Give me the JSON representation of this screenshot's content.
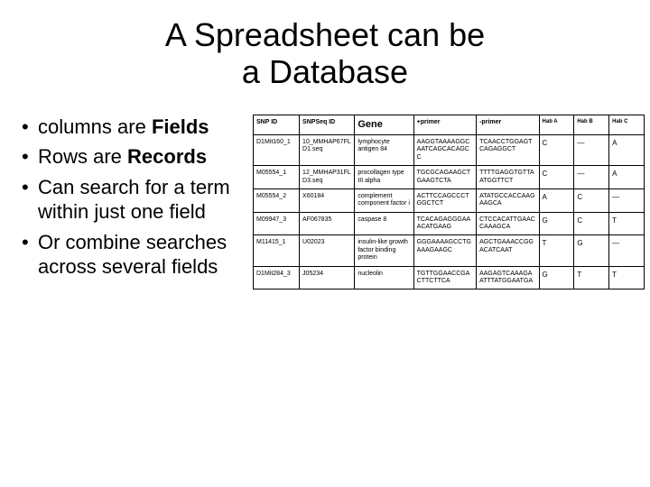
{
  "title_line1": "A Spreadsheet can be",
  "title_line2": "a Database",
  "bullets": {
    "b1a": "columns are ",
    "b1b": "Fields",
    "b2a": "Rows are ",
    "b2b": "Records",
    "b3": "Can search for a term within just one field",
    "b4": "Or combine searches across several fields"
  },
  "columns": {
    "c0": "SNP ID",
    "c1": "SNPSeq ID",
    "c2": "Gene",
    "c3": "+primer",
    "c4": "-primer",
    "c5": "Hab A",
    "c6": "Hab B",
    "c7": "Hab C"
  },
  "rows": [
    {
      "c0": "D1Mit160_1",
      "c1": "10_MMHAP67FLD1.seq",
      "c2": "lymphocyte antigen 84",
      "c3": "AAGGTAAAAGGCAATCAGCACAGCC",
      "c4": "TCAACCTGGAGTCAGAGGCT",
      "c5": "C",
      "c6": "—",
      "c7": "A"
    },
    {
      "c0": "M05554_1",
      "c1": "12_MMHAP31FLD3.seq",
      "c2": "procollagen type III alpha",
      "c3": "TGCGCAGAAGCTGAAGTCTA",
      "c4": "TTTTGAGGTGTTAATGGTTCT",
      "c5": "C",
      "c6": "—",
      "c7": "A"
    },
    {
      "c0": "M05554_2",
      "c1": "X60184",
      "c2": "complement component factor i",
      "c3": "ACTTCCAGCCCTGGCTCT",
      "c4": "ATATGCCACCAAGAAGCA",
      "c5": "A",
      "c6": "C",
      "c7": "—"
    },
    {
      "c0": "M09947_3",
      "c1": "AF067835",
      "c2": "caspase 8",
      "c3": "TCACAGAGGGAAACATGAAG",
      "c4": "CTCCACATTGAACCAAAGCA",
      "c5": "G",
      "c6": "C",
      "c7": "T"
    },
    {
      "c0": "M11415_1",
      "c1": "U02023",
      "c2": "insulin-like growth factor binding protein",
      "c3": "GGGAAAAGCCTGAAAGAAGC",
      "c4": "AGCTGAAACCGGACATCAAT",
      "c5": "T",
      "c6": "G",
      "c7": "—"
    },
    {
      "c0": "D1Mit284_3",
      "c1": "J05234",
      "c2": "nucleolin",
      "c3": "TGTTGGAACCGACTTCTTCA",
      "c4": "AAGAGTCAAAGAATTTATGGAATGA",
      "c5": "G",
      "c6": "T",
      "c7": "T"
    }
  ]
}
